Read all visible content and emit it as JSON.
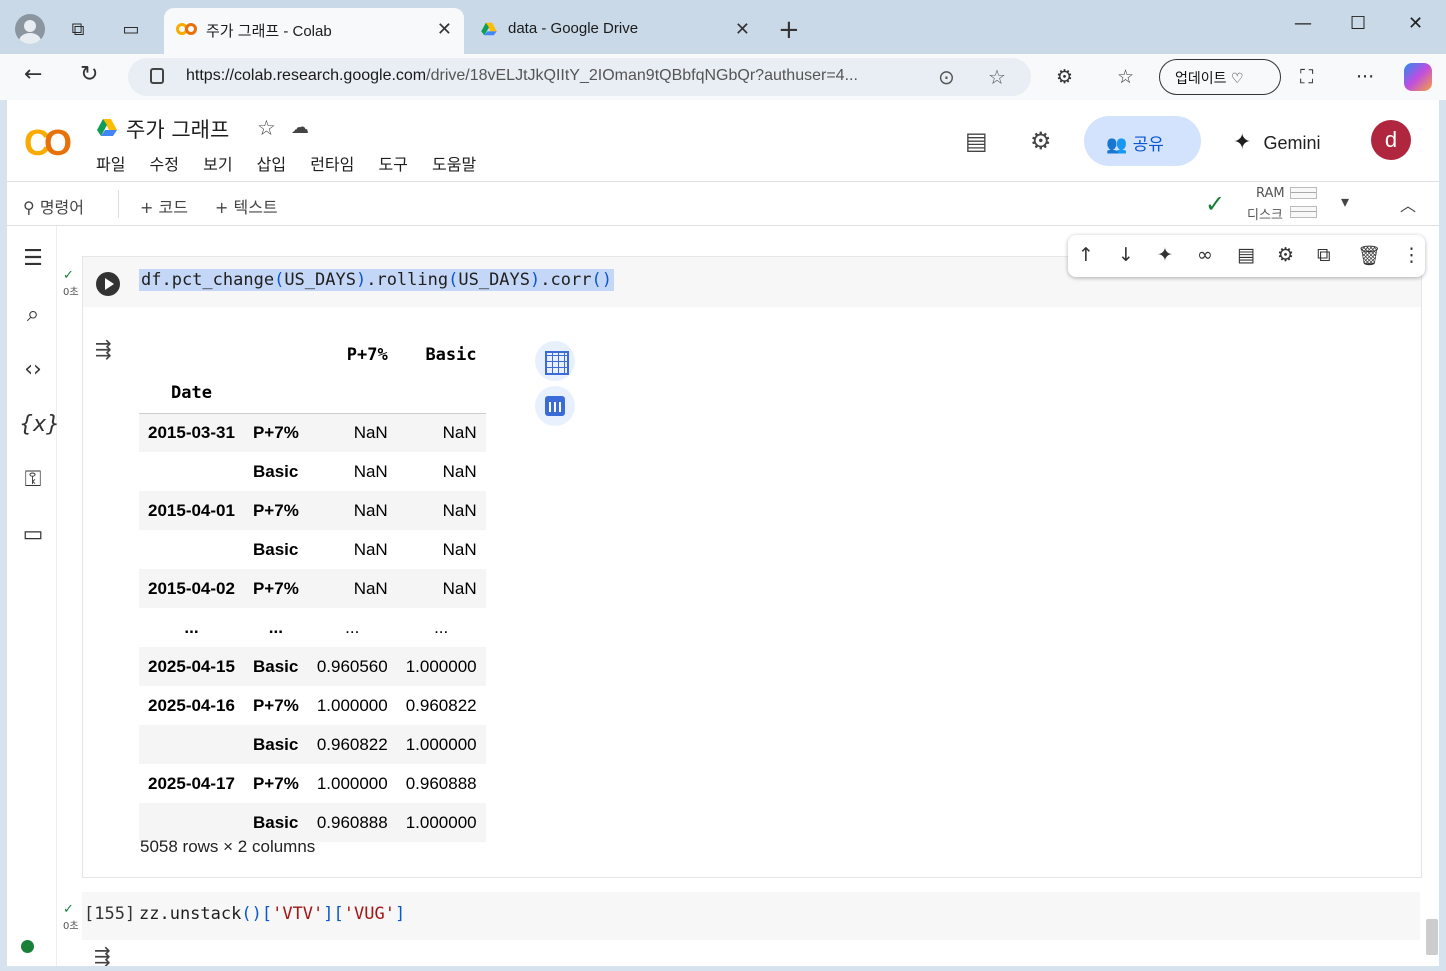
{
  "browser": {
    "tabs": [
      {
        "title": "주가 그래프 - Colab",
        "active": true
      },
      {
        "title": "data - Google Drive",
        "active": false
      }
    ],
    "url_domain": "https://colab.research.google.com",
    "url_path": "/drive/18vELJtJkQIItY_2IOman9tQBbfqNGbQr?authuser=4...",
    "update_label": "업데이트"
  },
  "colab": {
    "notebook_title": "주가 그래프",
    "menu": [
      "파일",
      "수정",
      "보기",
      "삽입",
      "런타임",
      "도구",
      "도움말"
    ],
    "share_label": "공유",
    "gemini_label": "Gemini",
    "avatar_letter": "d",
    "toolbar": {
      "commands": "명령어",
      "code": "+ 코드",
      "text": "+ 텍스트",
      "ram": "RAM",
      "disk": "디스크"
    },
    "colors": {
      "accent": "#0b57d0",
      "share_bg": "#d3e3fd",
      "avatar": "#b0263e",
      "ok": "#188038"
    }
  },
  "cell1": {
    "exec_time": "0초",
    "code_fn": "df.pct_change",
    "code_arg1": "US_DAYS",
    "code_mid": ".rolling",
    "code_arg2": "US_DAYS",
    "code_end": ".corr",
    "output": {
      "columns": [
        "P+7%",
        "Basic"
      ],
      "index_name": "Date",
      "rows": [
        {
          "date": "2015-03-31",
          "sub": "P+7%",
          "v1": "NaN",
          "v2": "NaN"
        },
        {
          "date": "",
          "sub": "Basic",
          "v1": "NaN",
          "v2": "NaN"
        },
        {
          "date": "2015-04-01",
          "sub": "P+7%",
          "v1": "NaN",
          "v2": "NaN"
        },
        {
          "date": "",
          "sub": "Basic",
          "v1": "NaN",
          "v2": "NaN"
        },
        {
          "date": "2015-04-02",
          "sub": "P+7%",
          "v1": "NaN",
          "v2": "NaN"
        },
        {
          "date": "...",
          "sub": "...",
          "v1": "...",
          "v2": "..."
        },
        {
          "date": "2025-04-15",
          "sub": "Basic",
          "v1": "0.960560",
          "v2": "1.000000"
        },
        {
          "date": "2025-04-16",
          "sub": "P+7%",
          "v1": "1.000000",
          "v2": "0.960822"
        },
        {
          "date": "",
          "sub": "Basic",
          "v1": "0.960822",
          "v2": "1.000000"
        },
        {
          "date": "2025-04-17",
          "sub": "P+7%",
          "v1": "1.000000",
          "v2": "0.960888"
        },
        {
          "date": "",
          "sub": "Basic",
          "v1": "0.960888",
          "v2": "1.000000"
        }
      ],
      "shape": "5058 rows × 2 columns"
    }
  },
  "cell2": {
    "exec_time": "0초",
    "number": "[155]",
    "code_obj": "zz.unstack",
    "key1": "'VTV'",
    "key2": "'VUG'"
  }
}
